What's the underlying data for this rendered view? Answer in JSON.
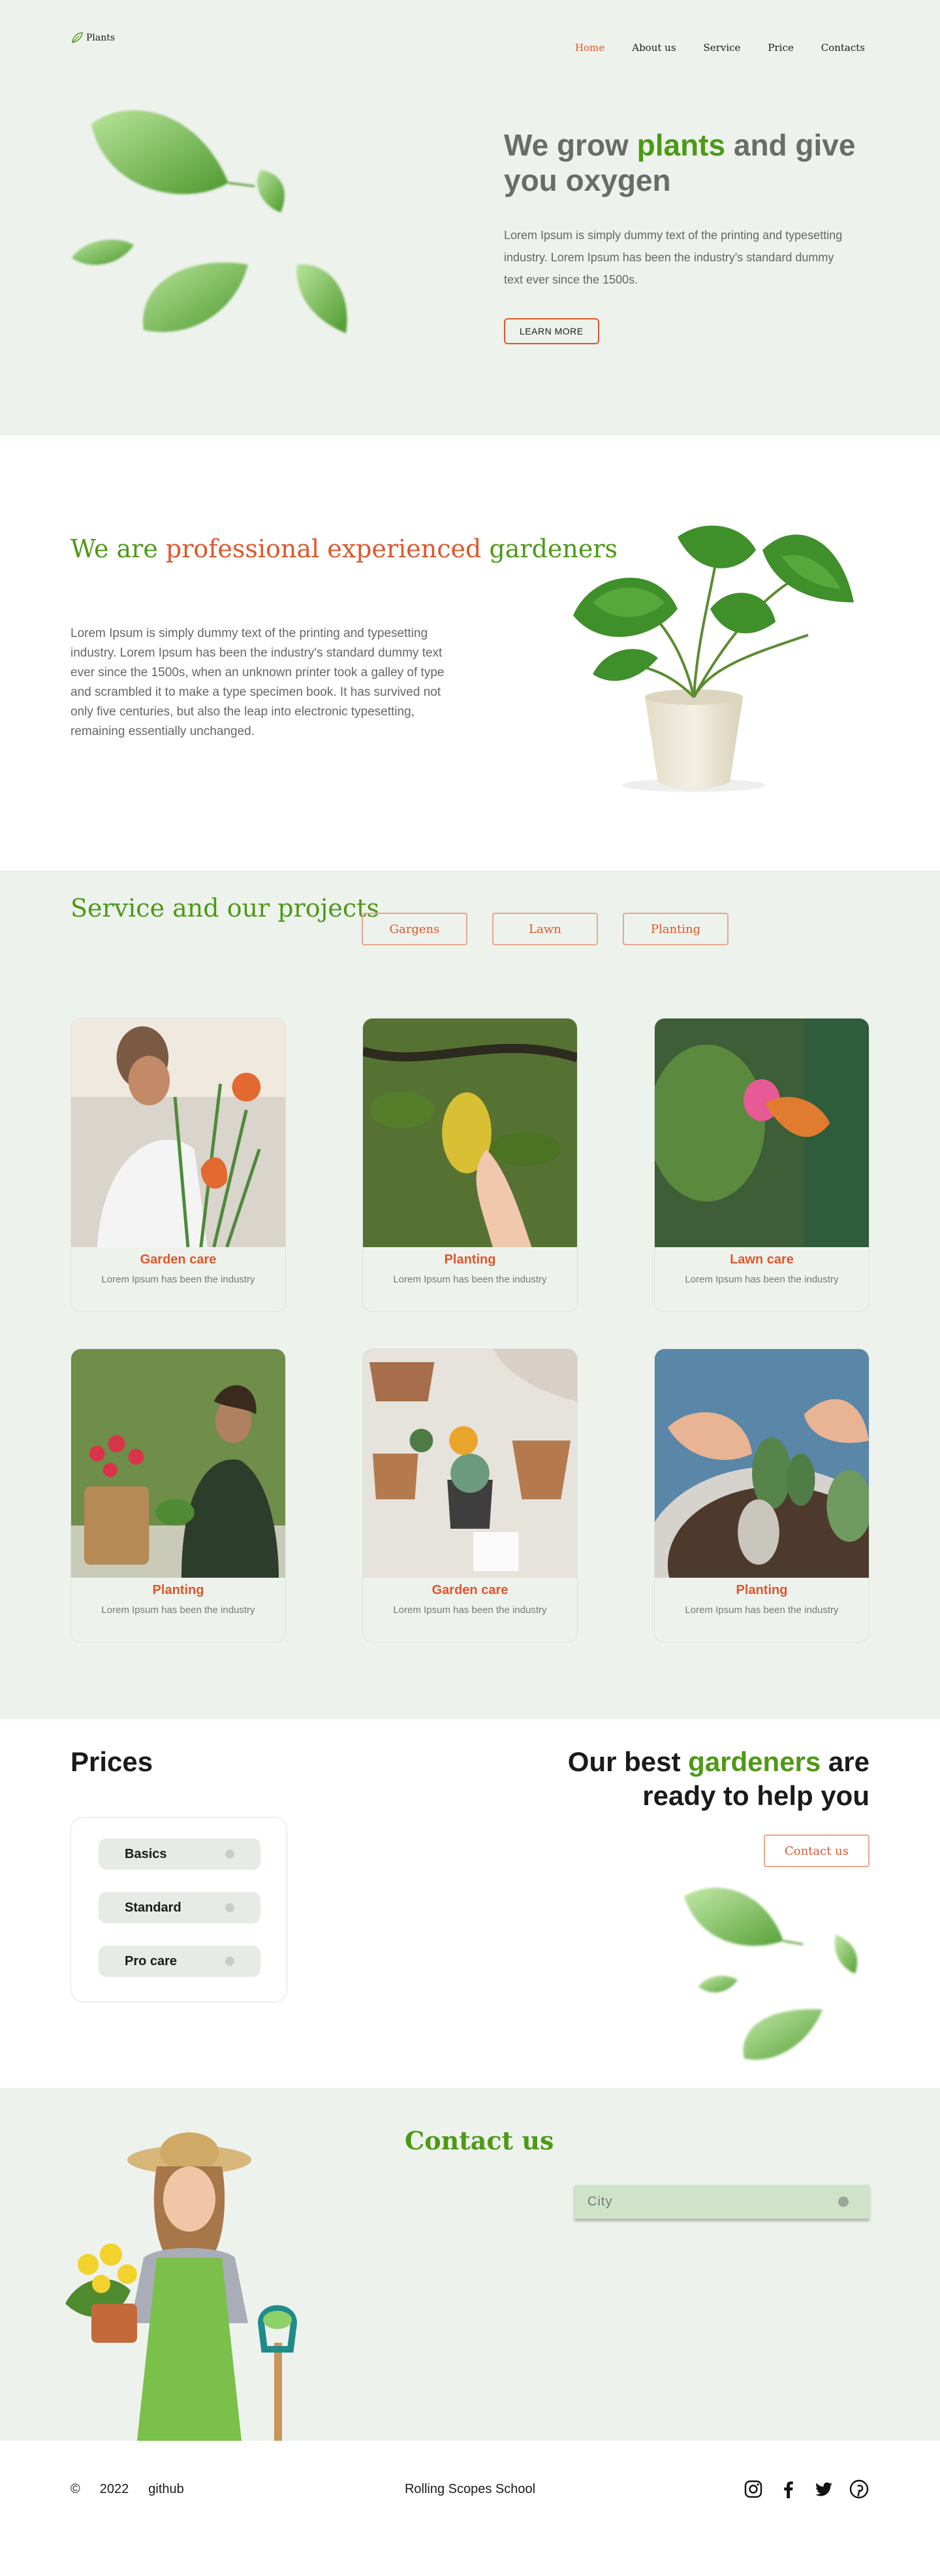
{
  "header": {
    "logo_text": "Plants",
    "nav": [
      "Home",
      "About us",
      "Service",
      "Price",
      "Contacts"
    ]
  },
  "hero": {
    "title_part1": "We grow ",
    "title_accent": "plants",
    "title_part2": " and give you oxygen",
    "text": "Lorem Ipsum is simply dummy text of the printing and typesetting industry. Lorem Ipsum has been the industry's standard dummy text ever since the 1500s.",
    "button": "LEARN MORE"
  },
  "about": {
    "title_1": "We are ",
    "title_2": "professional experienced",
    "title_3": " gardeners",
    "text": "Lorem Ipsum is simply dummy text of the printing and typesetting industry. Lorem Ipsum has been the industry's standard dummy text ever since the 1500s, when an unknown printer took a galley of type and scrambled it to make a type specimen book. It has survived not only five centuries, but also the leap into electronic typesetting, remaining essentially unchanged."
  },
  "service": {
    "title": "Service and our projects",
    "filters": [
      "Gargens",
      "Lawn",
      "Planting"
    ],
    "cards": [
      {
        "title": "Garden care",
        "desc": "Lorem Ipsum has been the industry"
      },
      {
        "title": "Planting",
        "desc": "Lorem Ipsum has been the industry"
      },
      {
        "title": "Lawn care",
        "desc": "Lorem Ipsum has been the industry"
      },
      {
        "title": "Planting",
        "desc": "Lorem Ipsum has been the industry"
      },
      {
        "title": "Garden care",
        "desc": "Lorem Ipsum has been the industry"
      },
      {
        "title": "Planting",
        "desc": "Lorem Ipsum has been the industry"
      }
    ]
  },
  "prices": {
    "title": "Prices",
    "items": [
      "Basics",
      "Standard",
      "Pro care"
    ],
    "best_1": "Our best ",
    "best_accent": "gardeners",
    "best_2": " are ready to help you",
    "contact_button": "Contact us"
  },
  "contact": {
    "title": "Contact us",
    "city_placeholder": "City"
  },
  "footer": {
    "copyright": "©",
    "year": "2022",
    "github": "github",
    "school": "Rolling Scopes School",
    "socials": [
      "instagram-icon",
      "facebook-icon",
      "twitter-icon",
      "pinterest-icon"
    ]
  },
  "colors": {
    "accent_green": "#4d9916",
    "accent_orange": "#e0562b",
    "section_bg": "#edf2ec"
  }
}
